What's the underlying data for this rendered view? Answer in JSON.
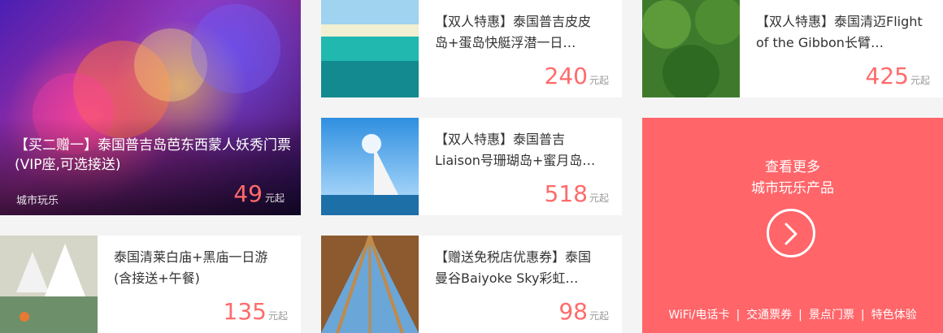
{
  "feature": {
    "title": "【买二赠一】泰国普吉岛芭东西蒙人妖秀门票(VIP座,可选接送)",
    "category": "城市玩乐",
    "price": "49",
    "unit": "元起"
  },
  "products": [
    {
      "id": "p1",
      "title": "【双人特惠】泰国普吉皮皮岛+蛋岛快艇浮潜一日…",
      "price": "240",
      "unit": "元起"
    },
    {
      "id": "p2",
      "title": "【双人特惠】泰国清迈Flight of the Gibbon长臂…",
      "price": "425",
      "unit": "元起"
    },
    {
      "id": "p3",
      "title": "【双人特惠】泰国普吉Liaison号珊瑚岛+蜜月岛…",
      "price": "518",
      "unit": "元起"
    },
    {
      "id": "p4",
      "title": "泰国清莱白庙+黑庙一日游(含接送+午餐)",
      "price": "135",
      "unit": "元起"
    },
    {
      "id": "p5",
      "title": "【赠送免税店优惠券】泰国曼谷Baiyoke Sky彩虹…",
      "price": "98",
      "unit": "元起"
    }
  ],
  "promo": {
    "line1": "查看更多",
    "line2": "城市玩乐产品",
    "links": [
      "WiFi/电话卡",
      "交通票券",
      "景点门票",
      "特色体验"
    ],
    "separator": "|"
  },
  "icons": {
    "arrow": "chevron-right-icon"
  }
}
